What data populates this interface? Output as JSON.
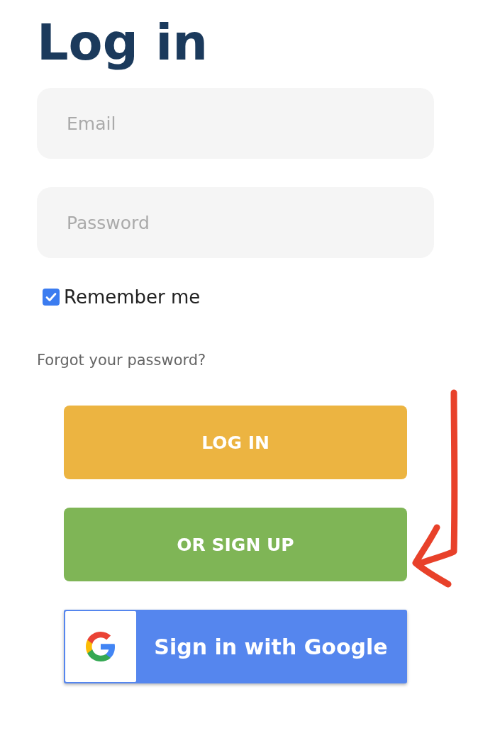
{
  "title": "Log in",
  "fields": [
    {
      "placeholder": "Email"
    },
    {
      "placeholder": "Password"
    }
  ],
  "remember": {
    "label": "Remember me",
    "checked": true
  },
  "forgot_link": "Forgot your password?",
  "buttons": [
    {
      "label": "LOG IN",
      "color": "#ecb441"
    },
    {
      "label": "OR SIGN UP",
      "color": "#7fb556"
    }
  ],
  "google_button": {
    "label": "Sign in with Google"
  }
}
